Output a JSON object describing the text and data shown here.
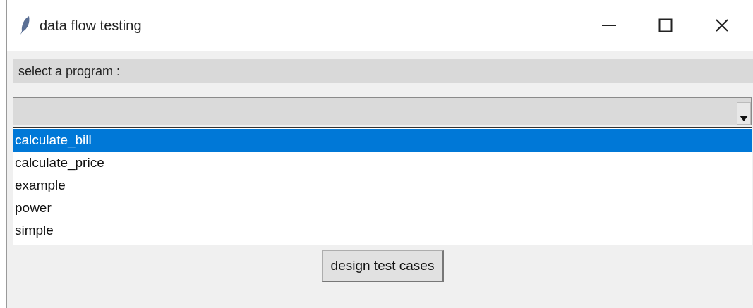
{
  "window": {
    "title": "data flow testing"
  },
  "label": "select a program :",
  "options": [
    {
      "label": "calculate_bill",
      "selected": true
    },
    {
      "label": "calculate_price",
      "selected": false
    },
    {
      "label": "example",
      "selected": false
    },
    {
      "label": "power",
      "selected": false
    },
    {
      "label": "simple",
      "selected": false
    }
  ],
  "button": "design test cases"
}
